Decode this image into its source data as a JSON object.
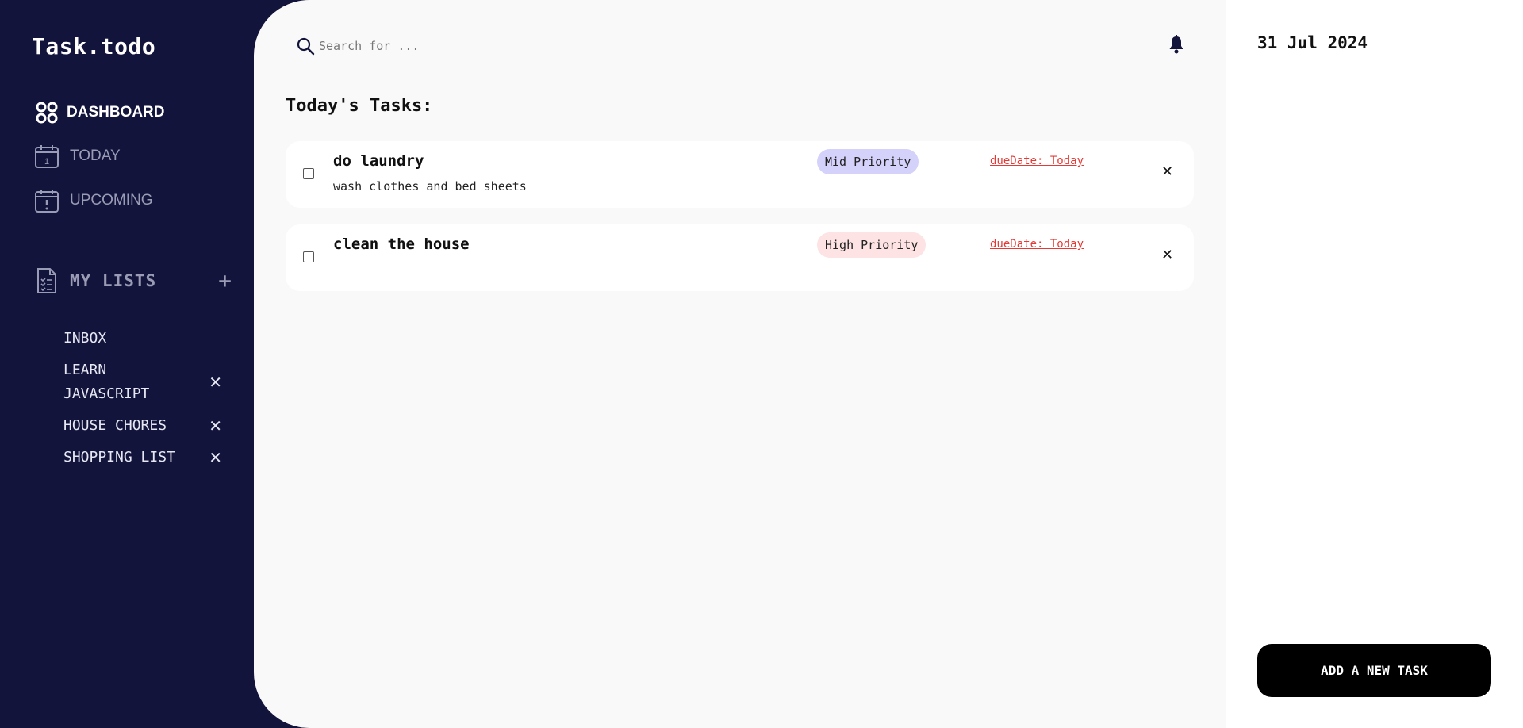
{
  "app": {
    "logo": "Task.todo"
  },
  "nav": [
    {
      "label": "DASHBOARD",
      "icon": "dashboard-icon",
      "active": true
    },
    {
      "label": "TODAY",
      "icon": "calendar-day-icon",
      "active": false
    },
    {
      "label": "UPCOMING",
      "icon": "calendar-alert-icon",
      "active": false
    }
  ],
  "my_lists": {
    "title": "MY LISTS",
    "add_label": "+",
    "items": [
      {
        "name": "INBOX",
        "deletable": false
      },
      {
        "name": "LEARN JAVASCRIPT",
        "deletable": true,
        "delete_label": "✕"
      },
      {
        "name": "HOUSE CHORES",
        "deletable": true,
        "delete_label": "✕"
      },
      {
        "name": "SHOPPING LIST",
        "deletable": true,
        "delete_label": "✕"
      }
    ]
  },
  "search": {
    "placeholder": "Search for ..."
  },
  "main": {
    "title": "Today's Tasks:"
  },
  "tasks": [
    {
      "title": "do laundry",
      "description": "wash clothes and bed sheets",
      "priority": "Mid Priority",
      "due": "dueDate: Today",
      "close_label": "✕"
    },
    {
      "title": "clean the house",
      "description": "",
      "priority": "High Priority",
      "due": "dueDate: Today",
      "close_label": "✕"
    }
  ],
  "right_panel": {
    "date": "31 Jul 2024",
    "add_button_label": "ADD A NEW TASK"
  },
  "colors": {
    "sidebar_bg": "#13143b",
    "main_bg": "#f9f9f9",
    "mid_priority": "#d4d1fb",
    "high_priority": "#fde3e3",
    "due_text": "#e53935",
    "button_bg": "#000000"
  }
}
